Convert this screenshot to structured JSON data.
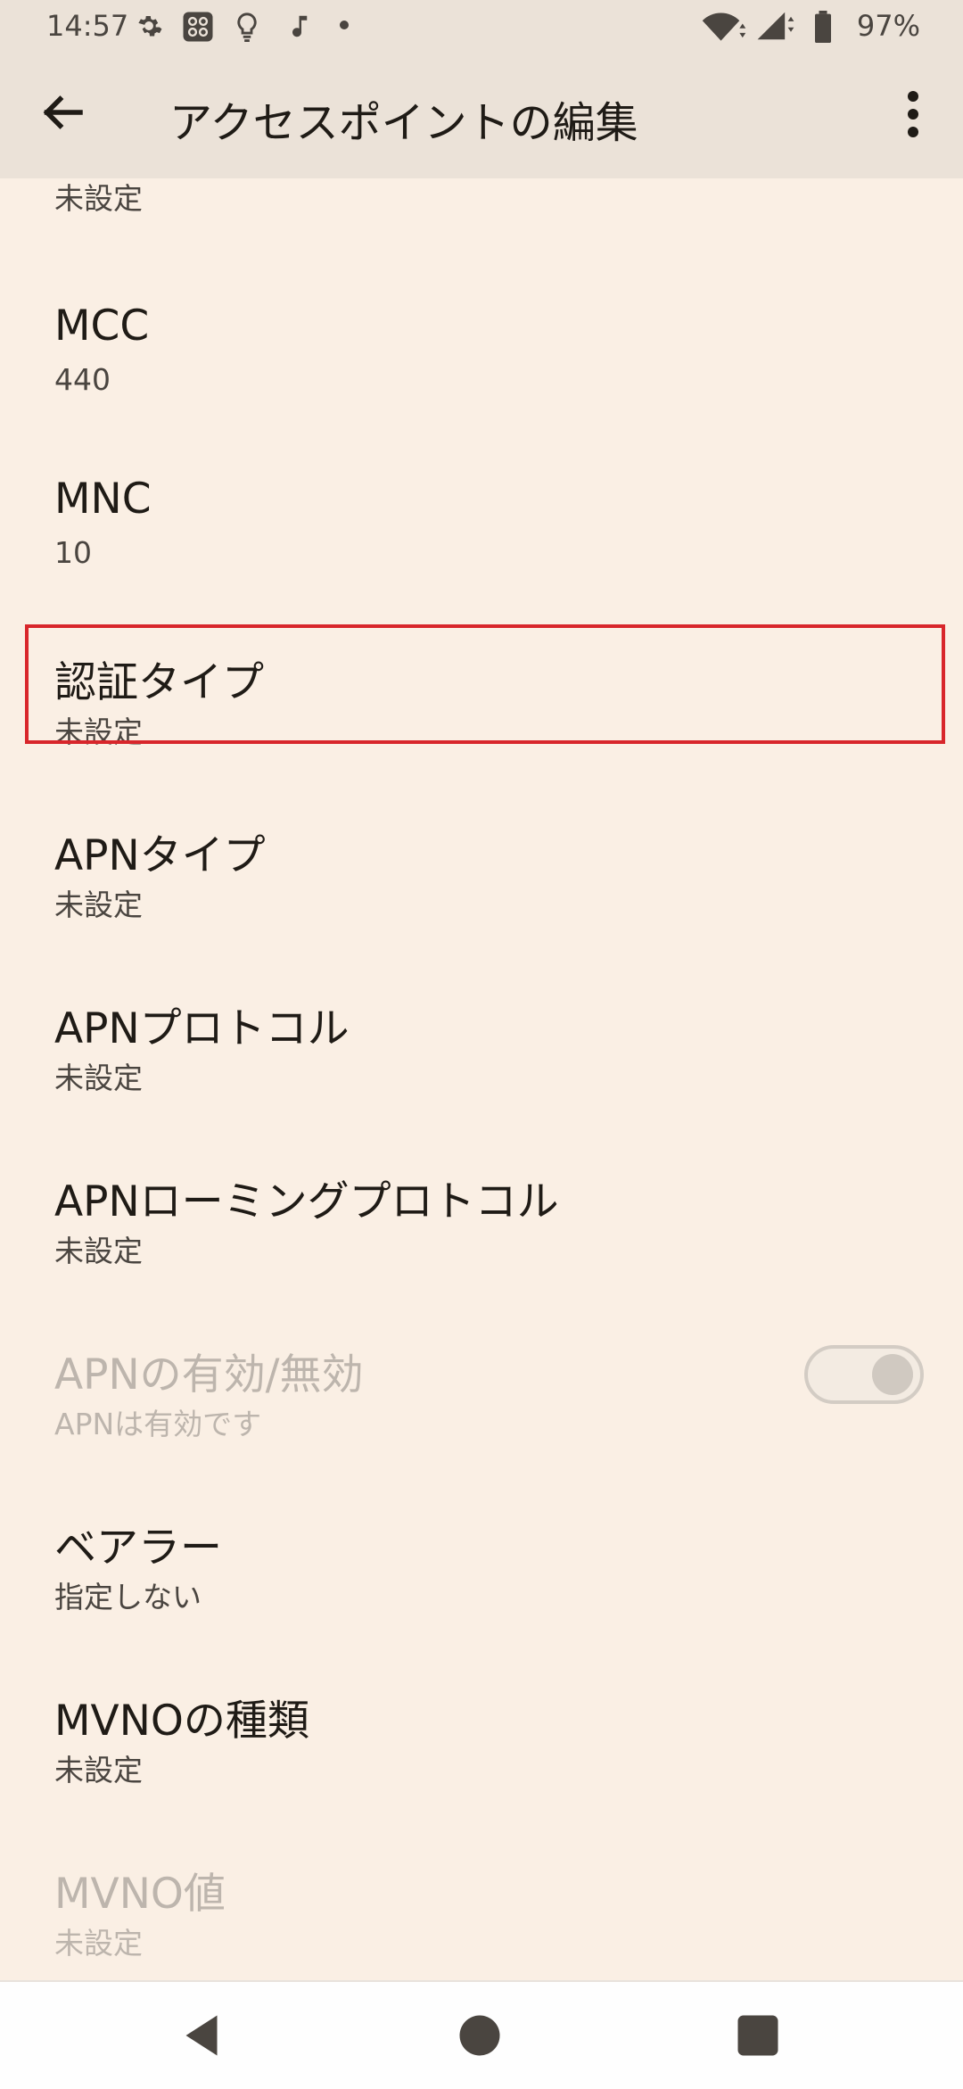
{
  "status_bar": {
    "time": "14:57",
    "battery_percent": "97%",
    "icons": [
      "gear-icon",
      "apps-grid-icon",
      "bulb-icon",
      "music-note-icon",
      "dot-icon",
      "wifi-icon",
      "signal-icon",
      "battery-icon"
    ]
  },
  "app_bar": {
    "title": "アクセスポイントの編集",
    "back_icon": "back-arrow-icon",
    "menu_icon": "more-vert-icon"
  },
  "partial_item": {
    "summary": "未設定"
  },
  "preferences": [
    {
      "title": "MCC",
      "summary": "440"
    },
    {
      "title": "MNC",
      "summary": "10"
    },
    {
      "title": "認証タイプ",
      "summary": "未設定",
      "highlighted": true
    },
    {
      "title": "APNタイプ",
      "summary": "未設定"
    },
    {
      "title": "APNプロトコル",
      "summary": "未設定"
    },
    {
      "title": "APNローミングプロトコル",
      "summary": "未設定"
    },
    {
      "title": "APNの有効/無効",
      "summary": "APNは有効です",
      "disabled": true,
      "toggle": "on"
    },
    {
      "title": "ベアラー",
      "summary": "指定しない"
    },
    {
      "title": "MVNOの種類",
      "summary": "未設定"
    },
    {
      "title": "MVNO値",
      "summary": "未設定",
      "disabled": true
    }
  ],
  "colors": {
    "background": "#faefe4",
    "app_bar": "#ebe2d8",
    "highlight_border": "#d8262b",
    "disabled_text": "#bdb5ad"
  },
  "nav_bar": {
    "icons": [
      "back-triangle-icon",
      "home-circle-icon",
      "recents-square-icon"
    ]
  }
}
